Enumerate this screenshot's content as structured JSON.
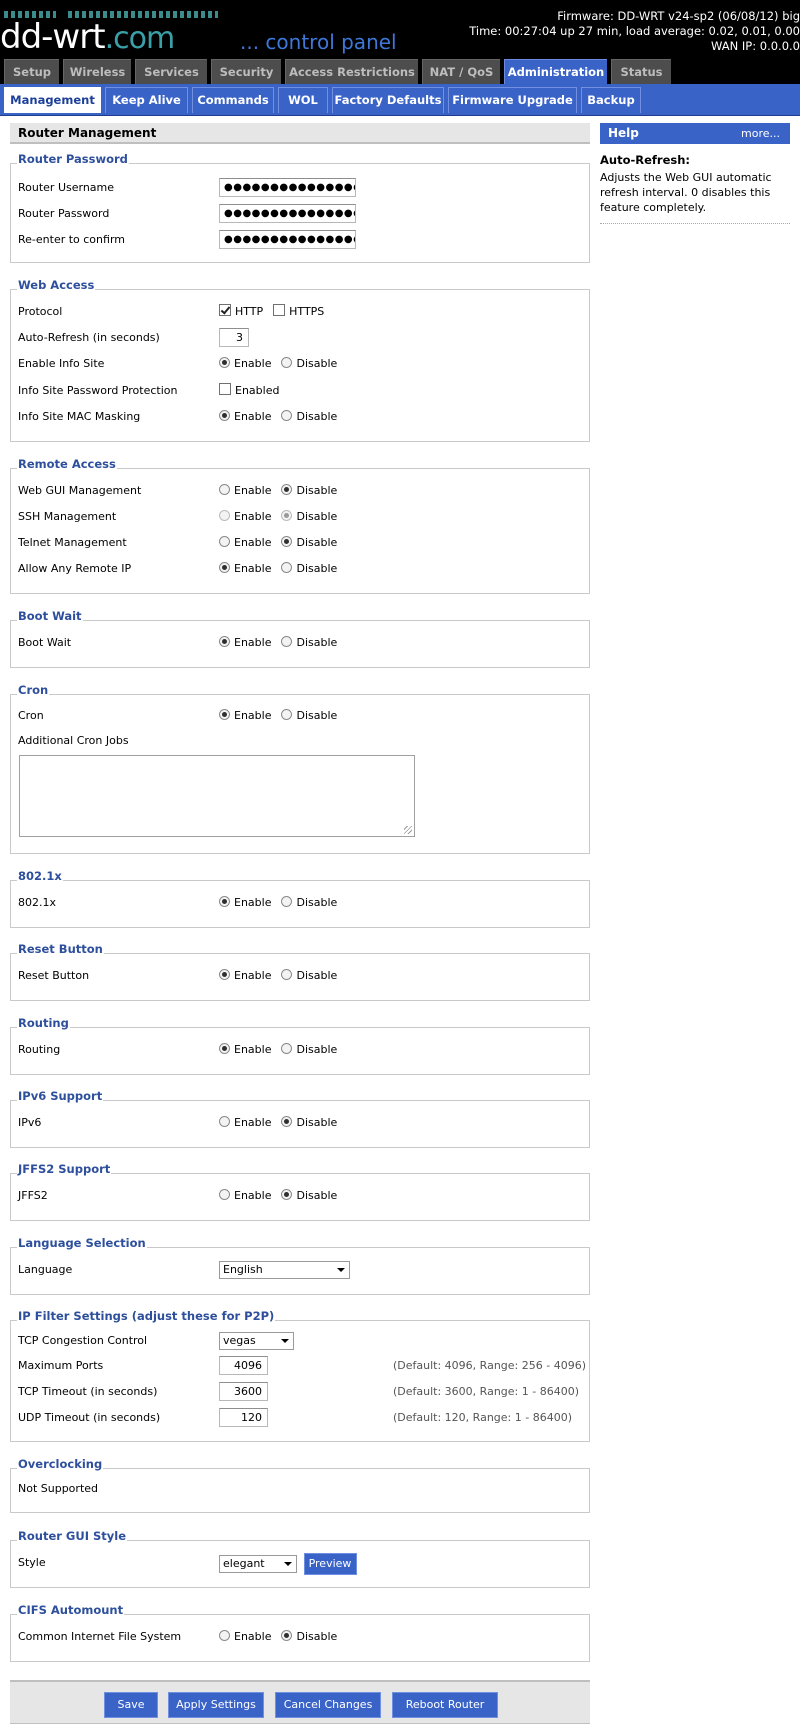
{
  "header": {
    "logo": "dd-wrt",
    "logo_suffix": ".com",
    "control_panel": "... control panel",
    "firmware": "Firmware: DD-WRT v24-sp2 (06/08/12) big",
    "time": "Time: 00:27:04 up 27 min, load average: 0.02, 0.01, 0.00",
    "wan_ip": "WAN IP: 0.0.0.0"
  },
  "tabs": [
    "Setup",
    "Wireless",
    "Services",
    "Security",
    "Access Restrictions",
    "NAT / QoS",
    "Administration",
    "Status"
  ],
  "subtabs": [
    "Management",
    "Keep Alive",
    "Commands",
    "WOL",
    "Factory Defaults",
    "Firmware Upgrade",
    "Backup"
  ],
  "page_title": "Router Management",
  "router_password": {
    "legend": "Router Password",
    "username_label": "Router Username",
    "username": "●●●●●●●●●●●●●●●●",
    "password_label": "Router Password",
    "password": "●●●●●●●●●●●●●●●●",
    "confirm_label": "Re-enter to confirm",
    "confirm": "●●●●●●●●●●●●●●●●"
  },
  "web_access": {
    "legend": "Web Access",
    "protocol_label": "Protocol",
    "http": "HTTP",
    "https": "HTTPS",
    "autorefresh_label": "Auto-Refresh (in seconds)",
    "autorefresh": "3",
    "infosite_label": "Enable Info Site",
    "infosite_pw_label": "Info Site Password Protection",
    "enabled": "Enabled",
    "mac_label": "Info Site MAC Masking"
  },
  "common": {
    "enable": "Enable",
    "disable": "Disable"
  },
  "remote_access": {
    "legend": "Remote Access",
    "webgui_label": "Web GUI Management",
    "ssh_label": "SSH Management",
    "telnet_label": "Telnet Management",
    "anyip_label": "Allow Any Remote IP"
  },
  "boot_wait": {
    "legend": "Boot Wait",
    "label": "Boot Wait"
  },
  "cron": {
    "legend": "Cron",
    "label": "Cron",
    "jobs_label": "Additional Cron Jobs"
  },
  "dot1x": {
    "legend": "802.1x",
    "label": "802.1x"
  },
  "reset": {
    "legend": "Reset Button",
    "label": "Reset Button"
  },
  "routing": {
    "legend": "Routing",
    "label": "Routing"
  },
  "ipv6": {
    "legend": "IPv6 Support",
    "label": "IPv6"
  },
  "jffs2": {
    "legend": "JFFS2 Support",
    "label": "JFFS2"
  },
  "language": {
    "legend": "Language Selection",
    "label": "Language",
    "value": "English"
  },
  "ipfilter": {
    "legend": "IP Filter Settings (adjust these for P2P)",
    "tcp_cc_label": "TCP Congestion Control",
    "tcp_cc": "vegas",
    "maxports_label": "Maximum Ports",
    "maxports": "4096",
    "maxports_hint": "(Default: 4096, Range: 256 - 4096)",
    "tcp_to_label": "TCP Timeout (in seconds)",
    "tcp_to": "3600",
    "tcp_to_hint": "(Default: 3600, Range: 1 - 86400)",
    "udp_to_label": "UDP Timeout (in seconds)",
    "udp_to": "120",
    "udp_to_hint": "(Default: 120, Range: 1 - 86400)"
  },
  "overclocking": {
    "legend": "Overclocking",
    "text": "Not Supported"
  },
  "gui_style": {
    "legend": "Router GUI Style",
    "label": "Style",
    "value": "elegant",
    "preview": "Preview"
  },
  "cifs": {
    "legend": "CIFS Automount",
    "label": "Common Internet File System"
  },
  "buttons": {
    "save": "Save",
    "apply": "Apply Settings",
    "cancel": "Cancel Changes",
    "reboot": "Reboot Router"
  },
  "help": {
    "title": "Help",
    "more": "more...",
    "topic": "Auto-Refresh:",
    "text": "Adjusts the Web GUI automatic refresh interval. 0 disables this feature completely."
  },
  "colors": {
    "accent": "#3a63c8",
    "legend": "#2d4f9c",
    "logo_teal": "#3aa0a8"
  }
}
